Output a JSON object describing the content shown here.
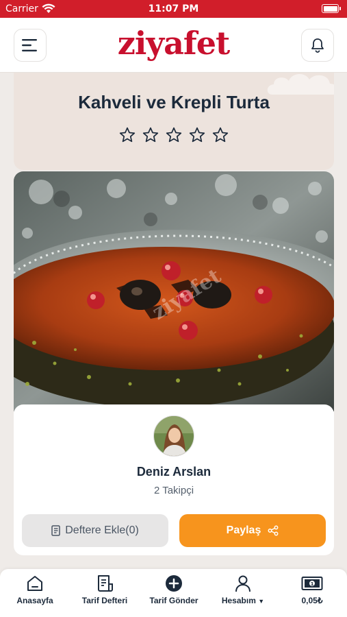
{
  "status_bar": {
    "carrier": "Carrier",
    "time": "11:07 PM"
  },
  "header": {
    "logo": "ziyafet"
  },
  "recipe": {
    "title": "Kahveli ve Krepli Turta",
    "rating": 0,
    "max_rating": 5
  },
  "photo": {
    "watermark": "ziyafet"
  },
  "author": {
    "name": "Deniz Arslan",
    "followers": "2 Takipçi"
  },
  "actions": {
    "add_to_notebook": "Deftere Ekle(0)",
    "share": "Paylaş"
  },
  "bottom_nav": {
    "home": "Anasayfa",
    "notebook": "Tarif Defteri",
    "submit": "Tarif Gönder",
    "account": "Hesabım",
    "balance": "0,05₺"
  },
  "colors": {
    "brand": "#c8102e",
    "accent": "#f7941d",
    "statusbar": "#d11e2a"
  }
}
